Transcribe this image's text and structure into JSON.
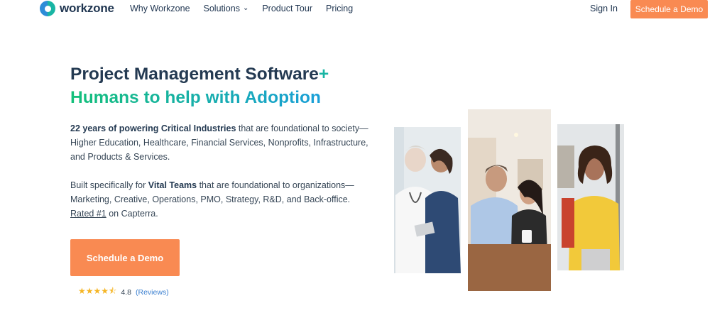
{
  "nav": {
    "logo_text": "workzone",
    "links": [
      "Why Workzone",
      "Solutions",
      "Product Tour",
      "Pricing"
    ],
    "sign_in": "Sign In",
    "cta": "Schedule a Demo"
  },
  "hero": {
    "title_line1": "Project Management Software",
    "title_plus": "+",
    "title_line2": "Humans to help with Adoption",
    "p1_bold": "22 years of powering Critical Industries",
    "p1_rest": " that are foundational to society—Higher Education, Healthcare, Financial Services, Nonprofits, Infrastructure, and Products & Services.",
    "p2_start": "Built specifically for ",
    "p2_bold": "Vital Teams",
    "p2_mid": " that are foundational to organizations—Marketing, Creative, Operations, PMO, Strategy, R&D, and Back-office. ",
    "p2_link": "Rated #1",
    "p2_end": " on Capterra.",
    "cta": "Schedule a Demo",
    "rating_stars": "★★★★⯪",
    "rating_value": "4.8",
    "reviews_link": "(Reviews)"
  },
  "colors": {
    "accent_orange": "#f98a52",
    "brand_teal": "#19b5a4",
    "heading_navy": "#243a52"
  }
}
